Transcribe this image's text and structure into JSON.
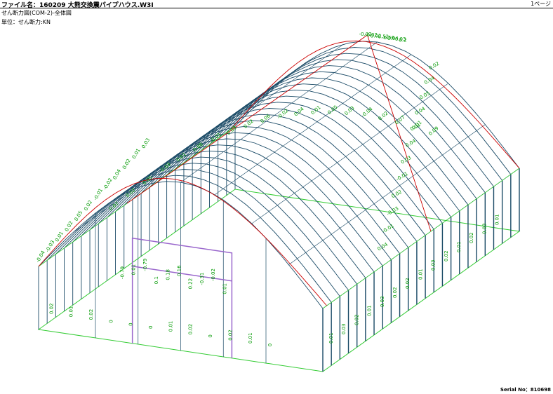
{
  "header": {
    "file_title": "ファイル名：160209 大熊交換震パイプハウス.W3I",
    "page": "1ページ"
  },
  "drawing_title": "せん断力図(COM-2)-全体図",
  "unit_label": "単位：せん断力:KN",
  "footer": {
    "serial": "Serial No：810698"
  },
  "colors": {
    "frame_ground": "#33cc33",
    "member": "#1a4a66",
    "value_text": "#009900",
    "diagram_red": "#cc0000",
    "brace_purple": "#9966cc"
  },
  "labels": {
    "front_left": [
      "-0.04",
      "-0.03",
      "0.01",
      "0.02",
      "0.05",
      "0.02",
      "-0.01",
      "-0.02",
      "0.04",
      "0.02",
      "0.01",
      "0.03"
    ],
    "ridge_top": [
      "-0.02",
      "-0.02",
      "0.02",
      "-0.52",
      "-0.56",
      "0.04",
      "-0.03",
      "0.2"
    ],
    "right_curve": [
      "0.02",
      "0.04",
      "0.05",
      "0.04",
      "0.01",
      "0.04",
      "0.03",
      "-0.01",
      "0.02",
      "-0.03",
      "-0.01",
      "0.04"
    ],
    "door_area": [
      "-0.79",
      "0.01",
      "-0.79",
      "0.1",
      "0.18",
      "0.16",
      "0.22",
      "-0.31",
      "-0.02",
      "0.01"
    ],
    "roof_field": [
      "0.07",
      "0.02",
      "0.05",
      "-0.03",
      "0.01",
      "0.08",
      "-0.01",
      "0.03",
      "0.02",
      "0.06",
      "-0.02",
      "0.04",
      "0.01",
      "0.05",
      "0.03",
      "-0.04",
      "0.02",
      "0.07",
      "0.01",
      "0.09"
    ],
    "gable_bottom": [
      "0.02",
      "0.01",
      "0.02",
      "0",
      "0",
      "0",
      "0.01",
      "0.02",
      "0",
      "0.02",
      "0.01",
      "0"
    ],
    "right_columns": [
      "0.01",
      "0.03",
      "0.02",
      "0.01",
      "0.03",
      "0.02",
      "0.02",
      "0.01",
      "0.03",
      "0.02",
      "0.01",
      "0.02",
      "0.03",
      "0.01"
    ]
  }
}
